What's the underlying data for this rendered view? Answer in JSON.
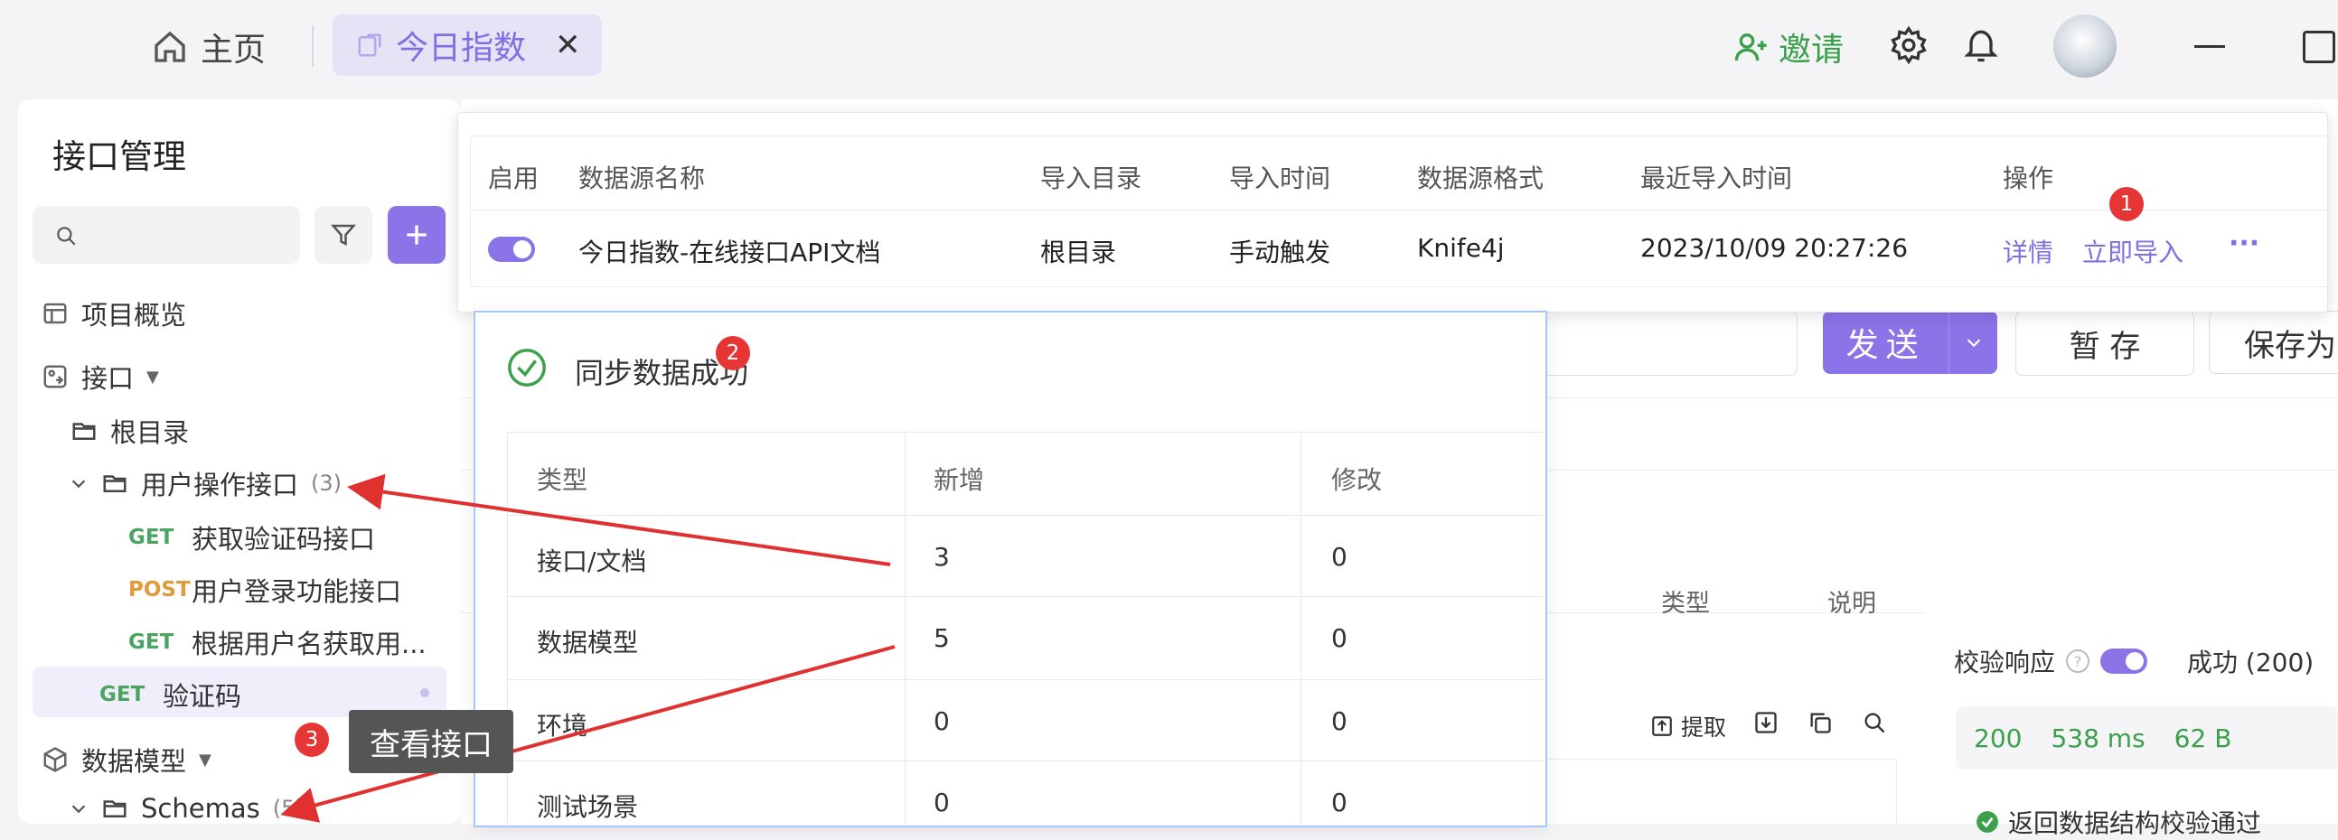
{
  "tabs": {
    "home_label": "主页",
    "active_label": "今日指数",
    "close_symbol": "✕"
  },
  "header": {
    "invite_label": "邀请"
  },
  "sidebar": {
    "title": "接口管理",
    "overview_label": "项目概览",
    "api_group_label": "接口",
    "root_label": "根目录",
    "folder_label": "用户操作接口",
    "folder_count": "(3)",
    "items": [
      {
        "method": "GET",
        "label": "获取验证码接口"
      },
      {
        "method": "POST",
        "label": "用户登录功能接口"
      },
      {
        "method": "GET",
        "label": "根据用户名获取用..."
      }
    ],
    "selected": {
      "method": "GET",
      "label": "验证码"
    },
    "model_label": "数据模型",
    "schemas_label": "Schemas",
    "schemas_count": "(5)"
  },
  "import_popup": {
    "headers": [
      "启用",
      "数据源名称",
      "导入目录",
      "导入时间",
      "数据源格式",
      "最近导入时间",
      "操作"
    ],
    "row": {
      "enabled": true,
      "name": "今日指数-在线接口API文档",
      "dir": "根目录",
      "time": "手动触发",
      "format": "Knife4j",
      "last": "2023/10/09 20:27:26",
      "detail_label": "详情",
      "import_label": "立即导入",
      "more": "···"
    }
  },
  "toolbar": {
    "send_label": "发送",
    "save_label": "暂 存",
    "save_as_label": "保存为"
  },
  "sync_result": {
    "title": "同步数据成功",
    "headers": [
      "类型",
      "新增",
      "修改"
    ],
    "rows": [
      {
        "type": "接口/文档",
        "added": "3",
        "modified": "0"
      },
      {
        "type": "数据模型",
        "added": "5",
        "modified": "0"
      },
      {
        "type": "环境",
        "added": "0",
        "modified": "0"
      },
      {
        "type": "测试场景",
        "added": "0",
        "modified": "0"
      }
    ]
  },
  "background": {
    "col_type": "类型",
    "col_desc": "说明",
    "extract_label": "提取",
    "validate_label": "校验响应",
    "status_label": "成功 (200)",
    "status_code": "200",
    "duration": "538 ms",
    "size": "62 B",
    "check_passed": "返回数据结构校验通过"
  },
  "annotations": {
    "step1": "1",
    "step2": "2",
    "step3": "3",
    "tooltip": "查看接口"
  },
  "colors": {
    "accent": "#8a74e8",
    "success": "#3aa04a",
    "arrow": "#e03030"
  }
}
